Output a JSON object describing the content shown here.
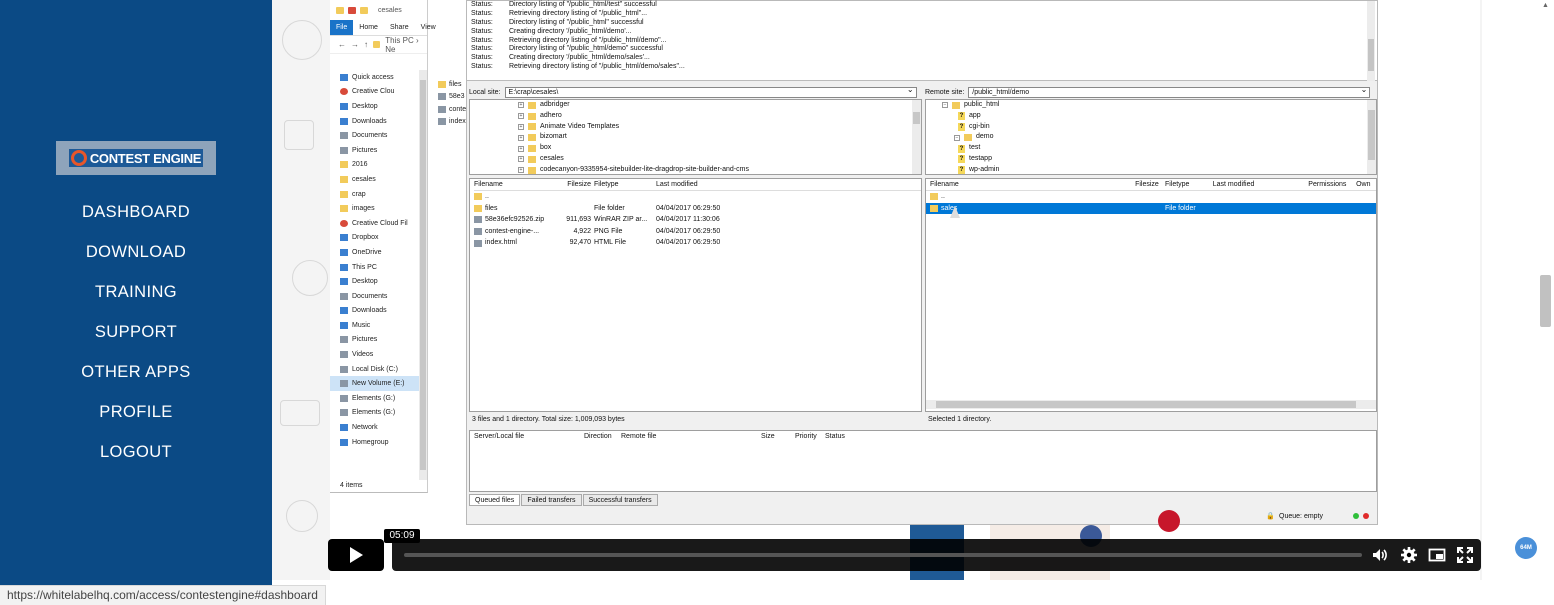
{
  "sidebar": {
    "logo_text": "CONTEST ENGINE",
    "nav": [
      "DASHBOARD",
      "DOWNLOAD",
      "TRAINING",
      "SUPPORT",
      "OTHER APPS",
      "PROFILE",
      "LOGOUT"
    ]
  },
  "explorer": {
    "title": "cesales",
    "ribbon": [
      "File",
      "Home",
      "Share",
      "View"
    ],
    "address": "This PC  ›  Ne",
    "tree": [
      {
        "label": "Quick access",
        "icon": "star-icon"
      },
      {
        "label": "Creative Clou",
        "icon": "creative-cloud-icon"
      },
      {
        "label": "Desktop",
        "icon": "desktop-icon"
      },
      {
        "label": "Downloads",
        "icon": "downloads-icon"
      },
      {
        "label": "Documents",
        "icon": "documents-icon"
      },
      {
        "label": "Pictures",
        "icon": "pictures-icon"
      },
      {
        "label": "2016",
        "icon": "folder-icon"
      },
      {
        "label": "cesales",
        "icon": "folder-icon"
      },
      {
        "label": "crap",
        "icon": "folder-icon"
      },
      {
        "label": "images",
        "icon": "folder-icon"
      },
      {
        "label": "Creative Cloud Fil",
        "icon": "creative-cloud-icon"
      },
      {
        "label": "Dropbox",
        "icon": "dropbox-icon"
      },
      {
        "label": "OneDrive",
        "icon": "onedrive-icon"
      },
      {
        "label": "This PC",
        "icon": "pc-icon"
      },
      {
        "label": "Desktop",
        "icon": "desktop-icon"
      },
      {
        "label": "Documents",
        "icon": "documents-icon"
      },
      {
        "label": "Downloads",
        "icon": "downloads-icon"
      },
      {
        "label": "Music",
        "icon": "music-icon"
      },
      {
        "label": "Pictures",
        "icon": "pictures-icon"
      },
      {
        "label": "Videos",
        "icon": "videos-icon"
      },
      {
        "label": "Local Disk (C:)",
        "icon": "disk-icon"
      },
      {
        "label": "New Volume (E:)",
        "icon": "disk-icon"
      },
      {
        "label": "Elements (G:)",
        "icon": "disk-icon"
      },
      {
        "label": "Elements (G:)",
        "icon": "disk-icon"
      },
      {
        "label": "Network",
        "icon": "network-icon"
      },
      {
        "label": "Homegroup",
        "icon": "homegroup-icon"
      }
    ],
    "files": [
      "files",
      "58e3",
      "conte",
      "index"
    ],
    "count": "4 items"
  },
  "filezilla": {
    "log": [
      [
        "Status:",
        "Directory listing of \"/public_html/test\" successful"
      ],
      [
        "Status:",
        "Retrieving directory listing of \"/public_html\"..."
      ],
      [
        "Status:",
        "Directory listing of \"/public_html\" successful"
      ],
      [
        "Status:",
        "Creating directory '/public_html/demo'..."
      ],
      [
        "Status:",
        "Retrieving directory listing of \"/public_html/demo\"..."
      ],
      [
        "Status:",
        "Directory listing of \"/public_html/demo\" successful"
      ],
      [
        "Status:",
        "Creating directory '/public_html/demo/sales'..."
      ],
      [
        "Status:",
        "Retrieving directory listing of \"/public_html/demo/sales\"..."
      ]
    ],
    "local_site_label": "Local site:",
    "local_site_value": "E:\\crap\\cesales\\",
    "remote_site_label": "Remote site:",
    "remote_site_value": "/public_html/demo",
    "local_tree": [
      "adbridger",
      "adhero",
      "Animate Video Templates",
      "bizomart",
      "box",
      "cesales",
      "codecanyon-9335954-sitebuilder-lite-dragdrop-site-builder-and-cms"
    ],
    "remote_tree": [
      {
        "label": "public_html",
        "type": "folder"
      },
      {
        "label": "app",
        "type": "unknown"
      },
      {
        "label": "cgi-bin",
        "type": "unknown"
      },
      {
        "label": "demo",
        "type": "folder"
      },
      {
        "label": "test",
        "type": "unknown"
      },
      {
        "label": "testapp",
        "type": "unknown"
      },
      {
        "label": "wp-admin",
        "type": "unknown"
      }
    ],
    "local_headers": [
      "Filename",
      "Filesize",
      "Filetype",
      "Last modified"
    ],
    "local_files": [
      [
        "..",
        "",
        "",
        ""
      ],
      [
        "files",
        "",
        "File folder",
        "04/04/2017 06:29:50"
      ],
      [
        "58e36efc92526.zip",
        "911,693",
        "WinRAR ZIP ar...",
        "04/04/2017 11:30:06"
      ],
      [
        "contest-engine-...",
        "4,922",
        "PNG File",
        "04/04/2017 06:29:50"
      ],
      [
        "index.html",
        "92,470",
        "HTML File",
        "04/04/2017 06:29:50"
      ]
    ],
    "local_status": "3 files and 1 directory. Total size: 1,009,093 bytes",
    "remote_headers": [
      "Filename",
      "Filesize",
      "Filetype",
      "Last modified",
      "Permissions",
      "Own"
    ],
    "remote_files": [
      [
        "..",
        "",
        "",
        "",
        "",
        ""
      ],
      [
        "sales",
        "",
        "File folder",
        "",
        "",
        ""
      ]
    ],
    "remote_status": "Selected 1 directory.",
    "queue_headers": [
      "Server/Local file",
      "Direction",
      "Remote file",
      "Size",
      "Priority",
      "Status"
    ],
    "tabs": [
      "Queued files",
      "Failed transfers",
      "Successful transfers"
    ],
    "queue_status": "Queue: empty"
  },
  "player": {
    "time_tooltip": "05:09",
    "badge": "64M"
  },
  "status_url": "https://whitelabelhq.com/access/contestengine#dashboard",
  "colors": {
    "sidebar_bg": "#0b4a85",
    "selection": "#0078d7",
    "logo_accent": "#e8562a"
  }
}
